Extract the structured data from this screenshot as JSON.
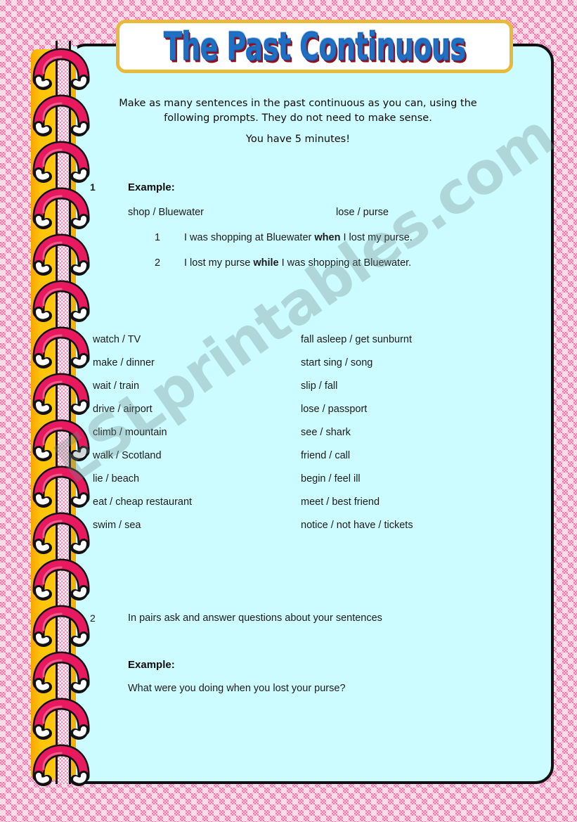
{
  "title": {
    "text": "The Past Continuous",
    "color": "#1f6fc4",
    "shadow_color": "#8f1020",
    "box_border_color": "#e8b93a"
  },
  "theme": {
    "page_background": "#ccfcff",
    "page_border": "#111111",
    "binder_strip": "#ffc40a",
    "ring_color": "#e8195f",
    "border_pattern": "pink-gingham",
    "border_pattern_colors": [
      "#e878ad",
      "#f6cfdf",
      "#ffffff"
    ]
  },
  "intro": {
    "line1": "Make as many sentences in the past continuous as you can, using the",
    "line2": "following prompts.  They do not need to make sense.",
    "line3": "You have 5 minutes!"
  },
  "section1": {
    "number": "1",
    "heading": "Example:",
    "example_prompt": {
      "left": "shop / Bluewater",
      "right": "lose / purse"
    },
    "example_sentences": [
      {
        "number": "1",
        "before": "I was shopping at Bluewater ",
        "keyword": "when",
        "after": " I lost my purse."
      },
      {
        "number": "2",
        "before": "I lost my purse ",
        "keyword": "while",
        "after": " I was shopping at Bluewater."
      }
    ]
  },
  "prompts": [
    {
      "left": "watch / TV",
      "right": "fall asleep / get sunburnt"
    },
    {
      "left": "make / dinner",
      "right": "start sing / song"
    },
    {
      "left": "wait / train",
      "right": "slip / fall"
    },
    {
      "left": "drive / airport",
      "right": "lose / passport"
    },
    {
      "left": "climb / mountain",
      "right": "see / shark"
    },
    {
      "left": "walk / Scotland",
      "right": "friend / call"
    },
    {
      "left": "lie / beach",
      "right": "begin / feel ill"
    },
    {
      "left": "eat / cheap restaurant",
      "right": "meet / best friend"
    },
    {
      "left": "swim / sea",
      "right": "notice / not have / tickets"
    }
  ],
  "section2": {
    "number": "2",
    "instruction": "In pairs ask and answer questions about your sentences",
    "heading": "Example:",
    "question": "What were you doing when you lost your purse?"
  },
  "watermark": {
    "text": "ESLprintables.com"
  },
  "binding": {
    "ring_count": 16
  }
}
